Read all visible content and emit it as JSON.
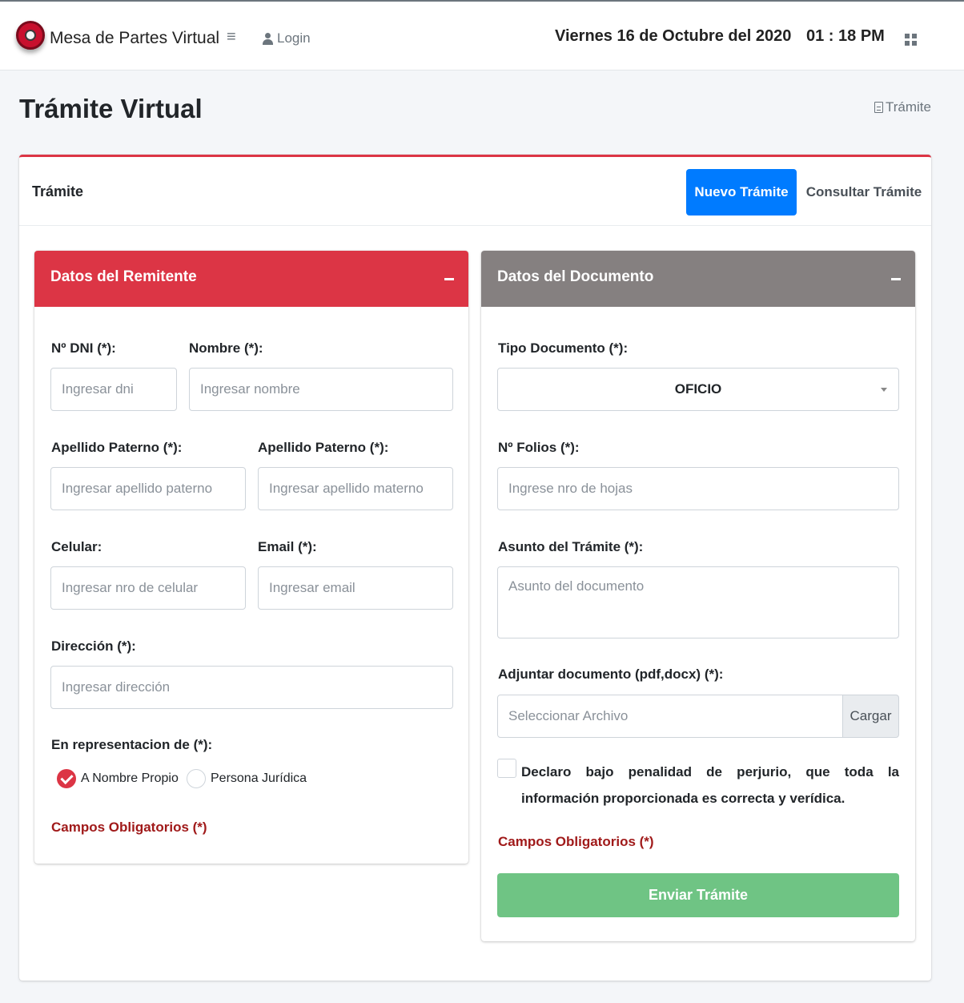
{
  "navbar": {
    "brand": "Mesa de Partes Virtual",
    "menu_icon": "hamburger-icon",
    "login_label": "Login",
    "date_text": "Viernes 16 de Octubre del 2020",
    "time_text": "01 : 18 PM",
    "apps_icon": "grid-icon"
  },
  "page": {
    "title": "Trámite Virtual",
    "breadcrumb": "Trámite"
  },
  "card": {
    "title": "Trámite",
    "nuevo_label": "Nuevo Trámite",
    "consultar_label": "Consultar Trámite"
  },
  "remitente": {
    "title": "Datos del Remitente",
    "dni_label": "Nº DNI (*):",
    "dni_placeholder": "Ingresar dni",
    "nombre_label": "Nombre (*):",
    "nombre_placeholder": "Ingresar nombre",
    "ap_paterno_label": "Apellido Paterno (*):",
    "ap_paterno_placeholder": "Ingresar apellido paterno",
    "ap_materno_label": "Apellido Paterno (*):",
    "ap_materno_placeholder": "Ingresar apellido materno",
    "celular_label": "Celular:",
    "celular_placeholder": "Ingresar nro de celular",
    "email_label": "Email (*):",
    "email_placeholder": "Ingresar email",
    "direccion_label": "Dirección (*):",
    "direccion_placeholder": "Ingresar dirección",
    "representacion_label": "En representacion de (*):",
    "option_propio": "A Nombre Propio",
    "option_juridica": "Persona Jurídica",
    "required_note": "Campos Obligatorios (*)"
  },
  "documento": {
    "title": "Datos del Documento",
    "tipo_label": "Tipo Documento (*):",
    "tipo_value": "OFICIO",
    "folios_label": "Nº Folios (*):",
    "folios_placeholder": "Ingrese nro de hojas",
    "asunto_label": "Asunto del Trámite (*):",
    "asunto_placeholder": "Asunto del documento",
    "adjuntar_label": "Adjuntar documento (pdf,docx) (*):",
    "archivo_placeholder": "Seleccionar Archivo",
    "cargar_label": "Cargar",
    "declaracion": "Declaro bajo penalidad de perjurio, que toda la información proporcionada es correcta y verídica.",
    "required_note": "Campos Obligatorios (*)",
    "enviar_label": "Enviar Trámite"
  },
  "colors": {
    "remitente_header": "#dc3545",
    "documento_header": "#858080",
    "primary": "#007bff",
    "success": "#6fc484"
  }
}
